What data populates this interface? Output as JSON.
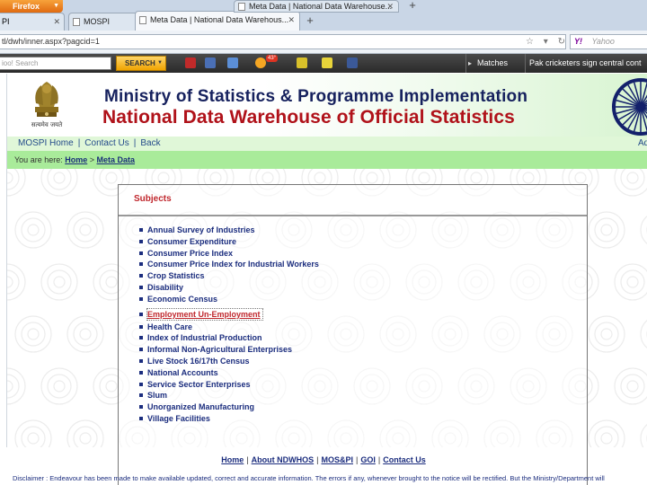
{
  "browser": {
    "menu_button": "Firefox",
    "tabs": [
      {
        "title": "PI"
      },
      {
        "title": "MOSPI"
      },
      {
        "title": "Meta Data | National Data Warehous..."
      },
      {
        "title": "Meta Data | National Data Warehouse..."
      }
    ],
    "address": "tl/dwh/inner.aspx?pagcid=1",
    "search_engine": {
      "placeholder": "Yahoo"
    }
  },
  "toolbar": {
    "search_placeholder": "ioo! Search",
    "search_button": "SEARCH",
    "badge": "43°",
    "matches": "Matches",
    "ticker": "Pak cricketers sign central cont"
  },
  "site": {
    "emblem_motto": "सत्यमेव जयते",
    "ministry": "Ministry of Statistics & Programme Implementation",
    "ndw": "National Data Warehouse of Official Statistics",
    "nav": {
      "home": "MOSPI Home",
      "contact": "Contact Us",
      "back": "Back",
      "right_cut": "Ad"
    },
    "breadcrumb": {
      "prefix": "You are here:",
      "home": "Home",
      "current": "Meta Data"
    },
    "subjects": {
      "heading": "Subjects",
      "items": [
        "Annual Survey of Industries",
        "Consumer Expenditure",
        "Consumer Price Index",
        "Consumer Price Index for Industrial Workers",
        "Crop Statistics",
        "Disability",
        "Economic Census",
        "Employment Un-Employment",
        "Health Care",
        "Index of Industrial Production",
        "Informal Non-Agricultural Enterprises",
        "Live Stock 16/17th Census",
        "National Accounts",
        "Service Sector Enterprises",
        "Slum",
        "Unorganized Manufacturing",
        "Village Facilities"
      ],
      "active_index": 7
    },
    "footer": {
      "links": [
        "Home",
        "About NDWHOS",
        "MOS&PI",
        "GOI",
        "Contact Us"
      ],
      "disclaimer": "Disclaimer : Endeavour has been made to make available updated, correct and accurate information. The errors if any, whenever brought to the notice will be rectified. But the Ministry/Department will"
    }
  },
  "colors": {
    "ministry_title": "#16215e",
    "ndw_title": "#b0121a",
    "nav_bar": "#e0f7d8",
    "breadcrumb_bar": "#a9eb9a",
    "link": "#1b2d7e",
    "heading": "#c0272d"
  }
}
